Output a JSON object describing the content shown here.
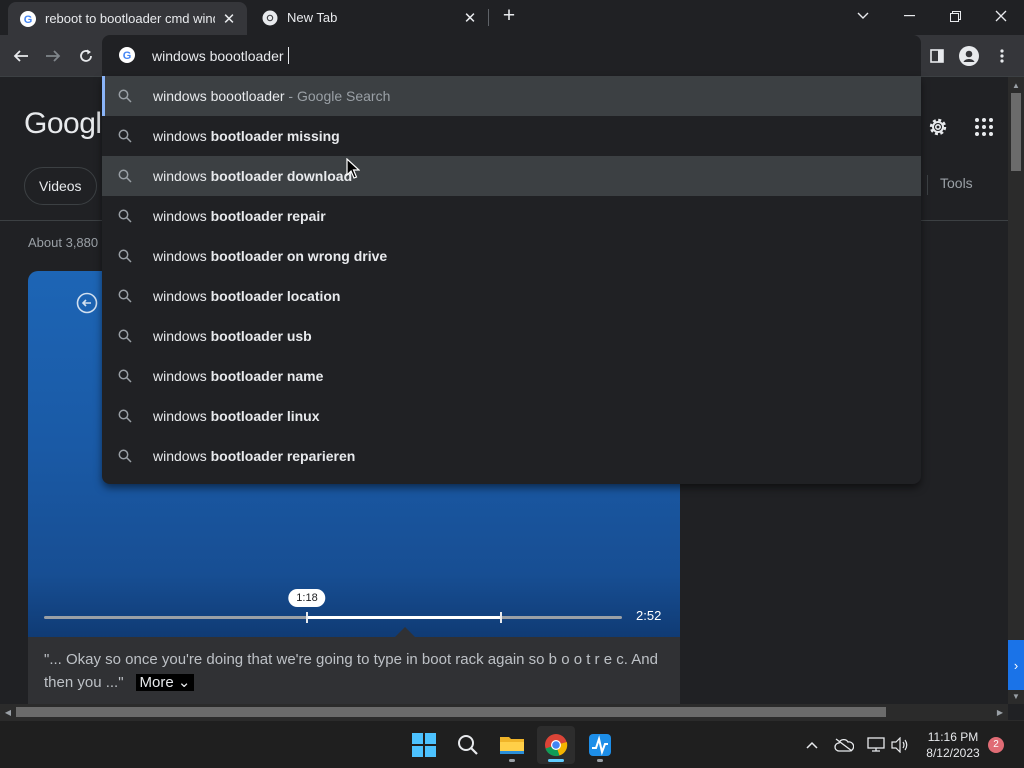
{
  "tabs": [
    {
      "title": "reboot to bootloader cmd windo",
      "favicon": "google-g-icon",
      "active": true
    },
    {
      "title": "New Tab",
      "favicon": "chrome-icon",
      "active": false
    }
  ],
  "window_controls": [
    "chevron-down-icon",
    "minimize-icon",
    "restore-icon",
    "close-icon"
  ],
  "omnibox": {
    "value": "windows boootloader",
    "favicon": "google-g-icon"
  },
  "suggestions": [
    {
      "prefix": "windows ",
      "bold": "",
      "plain": "boootloader",
      "suffix": " - Google Search",
      "selected": true
    },
    {
      "prefix": "windows ",
      "bold": "bootloader missing",
      "plain": "",
      "suffix": ""
    },
    {
      "prefix": "windows ",
      "bold": "bootloader download",
      "plain": "",
      "suffix": "",
      "hover": true
    },
    {
      "prefix": "windows ",
      "bold": "bootloader repair",
      "plain": "",
      "suffix": ""
    },
    {
      "prefix": "windows ",
      "bold": "bootloader on wrong drive",
      "plain": "",
      "suffix": ""
    },
    {
      "prefix": "windows ",
      "bold": "bootloader location",
      "plain": "",
      "suffix": ""
    },
    {
      "prefix": "windows ",
      "bold": "bootloader usb",
      "plain": "",
      "suffix": ""
    },
    {
      "prefix": "windows ",
      "bold": "bootloader name",
      "plain": "",
      "suffix": ""
    },
    {
      "prefix": "windows ",
      "bold": "bootloader linux",
      "plain": "",
      "suffix": ""
    },
    {
      "prefix": "windows ",
      "bold": "bootloader reparieren",
      "plain": "",
      "suffix": ""
    }
  ],
  "page": {
    "logo": "Googl",
    "chip_videos": "Videos",
    "tools": "Tools",
    "result_stats": "About 3,880"
  },
  "video": {
    "current_time": "1:18",
    "duration": "2:52",
    "played_fraction": 0.79,
    "current_fraction": 0.455,
    "caption": "\"... Okay so once you're doing that we're going to type in boot rack again so b o o t r e c. And then you ...\"",
    "more_label": "More"
  },
  "taskbar": {
    "apps": [
      "windows-start-icon",
      "search-icon",
      "file-explorer-icon",
      "chrome-icon",
      "activity-app-icon"
    ],
    "time": "11:16 PM",
    "date": "8/12/2023",
    "notifications": "2"
  },
  "colors": {
    "accent_blue": "#8ab4f8",
    "omnibox_bg": "#202124",
    "toolbar_bg": "#35363a",
    "video_blue": "#1d65b5"
  }
}
